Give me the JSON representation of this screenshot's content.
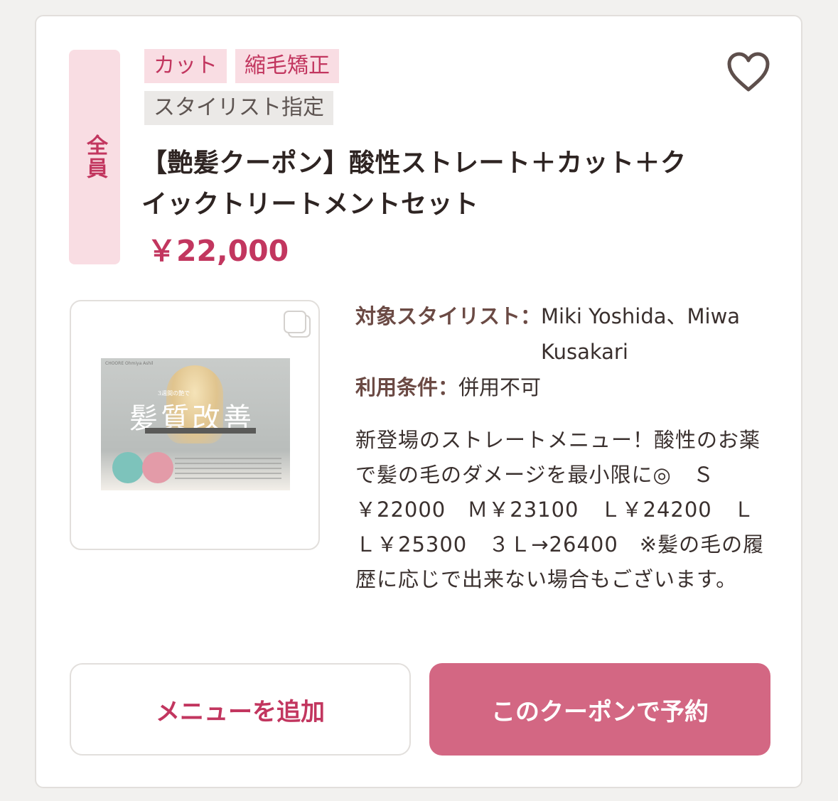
{
  "coupon": {
    "target": "全員",
    "tags_primary": [
      "カット",
      "縮毛矯正"
    ],
    "tag_secondary": "スタイリスト指定",
    "title": "【艶髪クーポン】酸性ストレート＋カット＋クイックトリートメントセット",
    "price": "￥22,000",
    "favorite_icon": "heart-outline-icon",
    "image": {
      "tagline": "3週間の艶で",
      "headline": "髪質改善",
      "small_header": "CHOORE Ohmiya Ashil"
    },
    "stylists_label": "対象スタイリスト：",
    "stylists_value": "Miki Yoshida、Miwa Kusakari",
    "conditions_label": "利用条件：",
    "conditions_value": "併用不可",
    "description": "新登場のストレートメニュー！酸性のお薬で髪の毛のダメージを最小限に◎　Ｓ￥22000　Ｍ￥23100　Ｌ￥24200　ＬＬ￥25300　３Ｌ→26400　※髪の毛の履歴に応じで出来ない場合もございます。"
  },
  "buttons": {
    "add_menu": "メニューを追加",
    "reserve": "このクーポンで予約"
  },
  "colors": {
    "accent": "#c2365f",
    "badge_bg": "#f9dde3",
    "reserve_bg": "#d36783"
  }
}
